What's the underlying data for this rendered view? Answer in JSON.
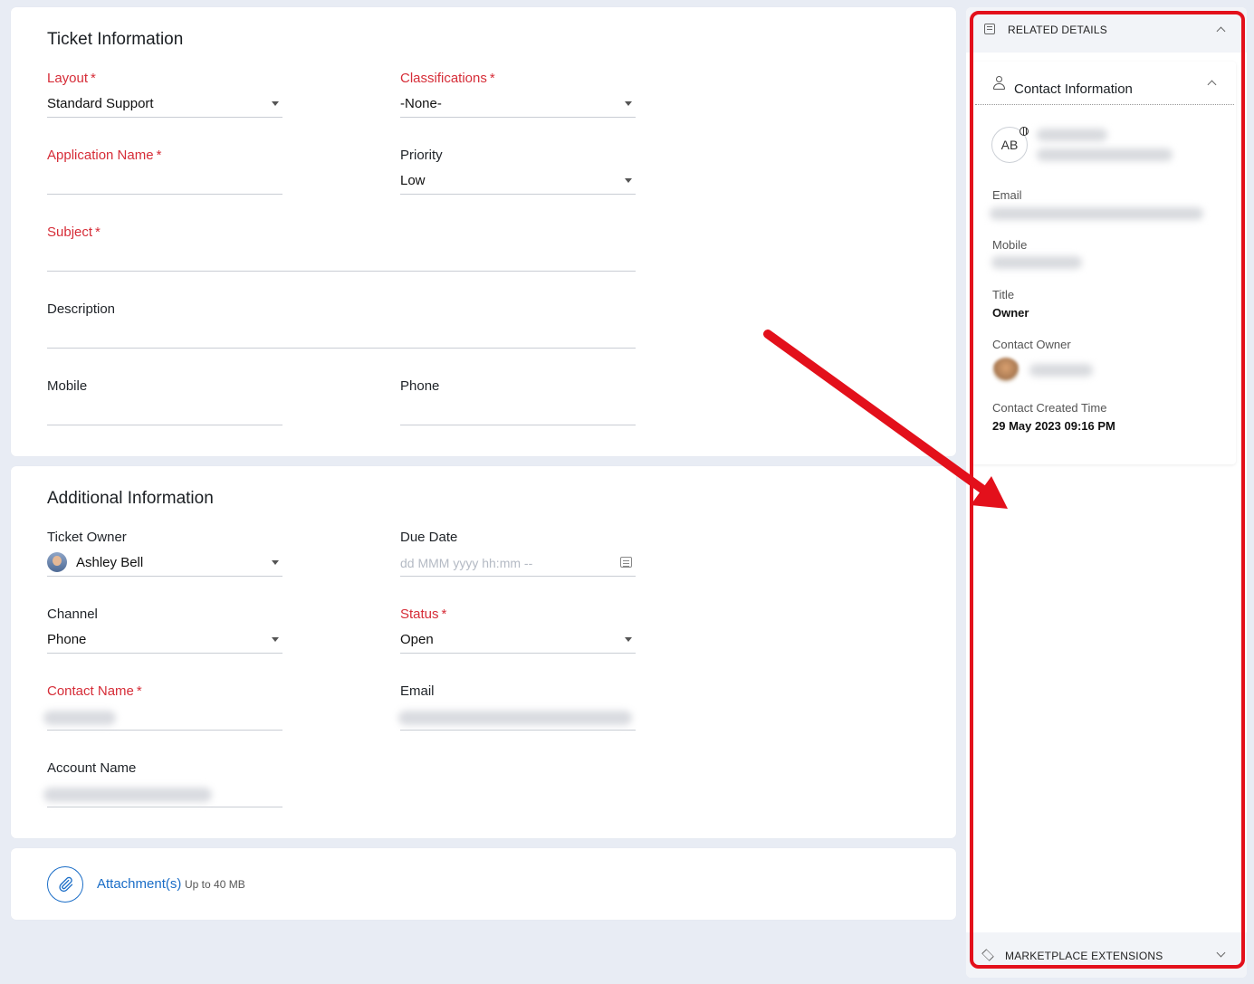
{
  "ticket_info": {
    "title": "Ticket Information",
    "layout": {
      "label": "Layout",
      "value": "Standard Support"
    },
    "classifications": {
      "label": "Classifications",
      "value": "-None-"
    },
    "application_name": {
      "label": "Application Name",
      "value": ""
    },
    "priority": {
      "label": "Priority",
      "value": "Low"
    },
    "subject": {
      "label": "Subject",
      "value": ""
    },
    "description": {
      "label": "Description",
      "value": ""
    },
    "mobile": {
      "label": "Mobile",
      "value": ""
    },
    "phone": {
      "label": "Phone",
      "value": ""
    },
    "required_mark": "*"
  },
  "additional_info": {
    "title": "Additional Information",
    "ticket_owner": {
      "label": "Ticket Owner",
      "value": "Ashley Bell"
    },
    "due_date": {
      "label": "Due Date",
      "placeholder": "dd MMM yyyy hh:mm --"
    },
    "channel": {
      "label": "Channel",
      "value": "Phone"
    },
    "status": {
      "label": "Status",
      "value": "Open"
    },
    "contact_name": {
      "label": "Contact Name"
    },
    "email": {
      "label": "Email"
    },
    "account_name": {
      "label": "Account Name"
    }
  },
  "attachments": {
    "link": "Attachment(s)",
    "hint": "Up to 40 MB"
  },
  "related_details": {
    "header": "RELATED DETAILS",
    "contact_card": {
      "title": "Contact Information",
      "avatar_initials": "AB",
      "email_label": "Email",
      "mobile_label": "Mobile",
      "title_label": "Title",
      "title_value": "Owner",
      "contact_owner_label": "Contact Owner",
      "created_time_label": "Contact Created Time",
      "created_time_value": "29 May 2023 09:16 PM"
    },
    "footer": "MARKETPLACE EXTENSIONS"
  },
  "colors": {
    "required": "#d62d38",
    "link": "#1a6dc7",
    "annotation": "#e3101b"
  },
  "icons": [
    "dropdown-caret-icon",
    "calendar-icon",
    "paperclip-icon",
    "related-details-icon",
    "user-icon",
    "globe-icon",
    "layers-icon",
    "chevron-up-icon",
    "chevron-down-icon"
  ]
}
